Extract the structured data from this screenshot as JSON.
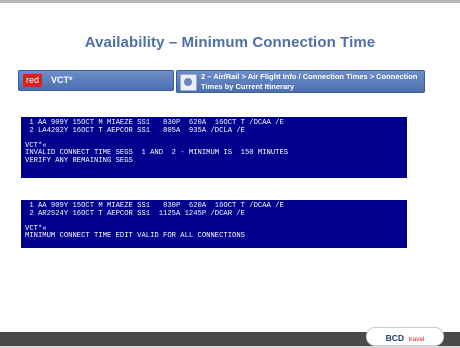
{
  "title": "Availability – Minimum Connection Time",
  "command": {
    "tag": "red",
    "text": "VCT*"
  },
  "path": {
    "text": "2 – Air/Rail > Air Flight Info / Connection Times > Connection Times by Current Itinerary"
  },
  "terminal1": {
    "lines": [
      " 1 AA 909Y 15OCT M MIAEZE SS1   830P  620A  16OCT T /DCAA /E",
      " 2 LA4202Y 16OCT T AEPCOR SS1   805A  935A /DCLA /E",
      "",
      "VCT*«",
      "INVALID CONNECT TIME SEGS  1 AND  2 - MINIMUM IS  150 MINUTES",
      "VERIFY ANY REMAINING SEGS"
    ]
  },
  "terminal2": {
    "lines": [
      " 1 AA 909Y 15OCT M MIAEZE SS1   830P  620A  16OCT T /DCAA /E",
      " 2 AR2524Y 16OCT T AEPCOR SS1  1125A 1245P /DCAR /E",
      "",
      "VCT*«",
      "MINIMUM CONNECT TIME EDIT VALID FOR ALL CONNECTIONS"
    ]
  },
  "logo": {
    "brand": "BCD",
    "suffix": "travel"
  }
}
